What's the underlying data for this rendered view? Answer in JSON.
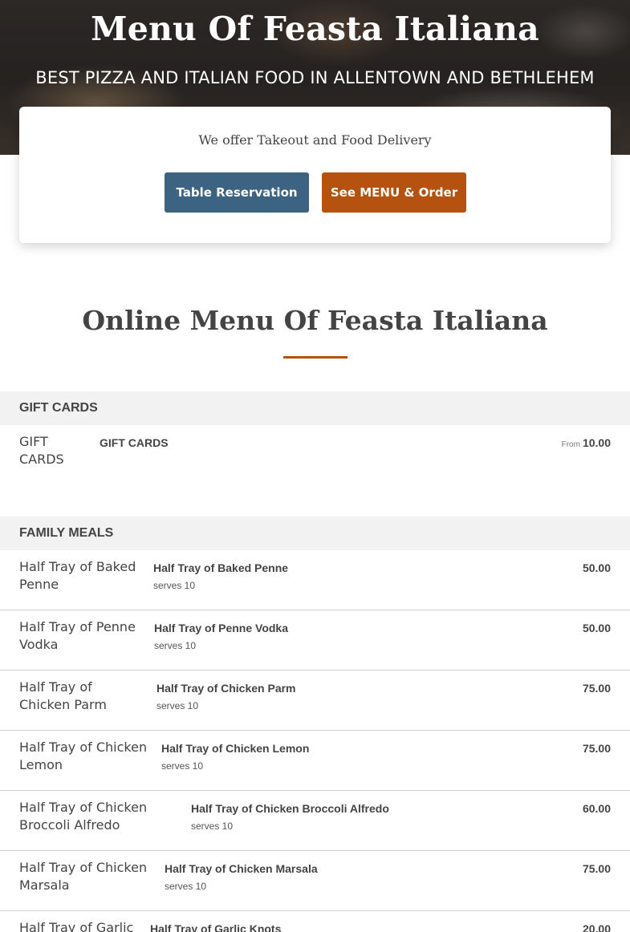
{
  "hero": {
    "title": "Menu Of Feasta Italiana",
    "subtitle": "BEST PIZZA AND ITALIAN FOOD IN ALLENTOWN AND BETHLEHEM"
  },
  "cta": {
    "text": "We offer Takeout and Food Delivery",
    "reserve_label": "Table Reservation",
    "order_label": "See MENU & Order"
  },
  "menu": {
    "title": "Online Menu Of Feasta Italiana",
    "categories": [
      {
        "name": "GIFT CARDS",
        "items": [
          {
            "image_alt": "GIFT CARDS",
            "name": "GIFT CARDS",
            "description": "",
            "price_prefix": "From",
            "price": "10.00"
          }
        ]
      },
      {
        "name": "FAMILY MEALS",
        "items": [
          {
            "image_alt": "Half Tray of Baked Penne",
            "name": "Half Tray of Baked Penne",
            "description": "serves 10",
            "price": "50.00"
          },
          {
            "image_alt": "Half Tray of Penne Vodka",
            "name": "Half Tray of Penne Vodka",
            "description": "serves 10",
            "price": "50.00"
          },
          {
            "image_alt": "Half Tray of Chicken Parm",
            "name": "Half Tray of Chicken Parm",
            "description": "serves 10",
            "price": "75.00"
          },
          {
            "image_alt": "Half Tray of Chicken Lemon",
            "name": "Half Tray of Chicken Lemon",
            "description": "serves 10",
            "price": "75.00"
          },
          {
            "image_alt": "Half Tray of Chicken Broccoli Alfredo",
            "name": "Half Tray of Chicken Broccoli Alfredo",
            "description": "serves 10",
            "price": "60.00"
          },
          {
            "image_alt": "Half Tray of Chicken Marsala",
            "name": "Half Tray of Chicken Marsala",
            "description": "serves 10",
            "price": "75.00"
          },
          {
            "image_alt": "Half Tray of Garlic Knots",
            "name": "Half Tray of Garlic Knots",
            "description": "",
            "price": "20.00"
          }
        ]
      }
    ]
  },
  "colors": {
    "reserve_button": "#3c6382",
    "order_button": "#b5520f",
    "accent_rule": "#b5520f"
  }
}
